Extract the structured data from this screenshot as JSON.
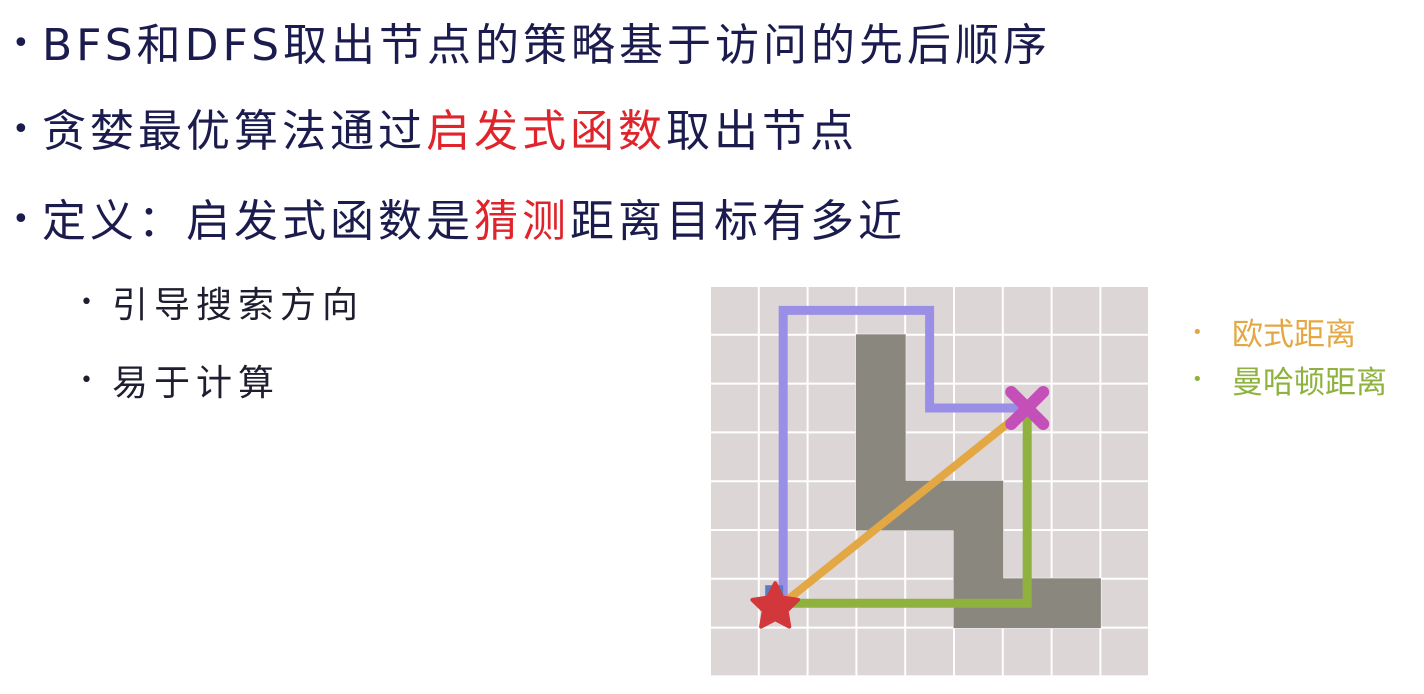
{
  "bullets": [
    {
      "text_before": "BFS和DFS取出节点的策略基于访问的先后顺序",
      "highlight": "",
      "text_after": ""
    },
    {
      "text_before": "贪婪最优算法通过",
      "highlight": "启发式函数",
      "text_after": "取出节点"
    },
    {
      "text_before": "定义：启发式函数是",
      "highlight": "猜测",
      "text_after": "距离目标有多近"
    }
  ],
  "sub_bullets": [
    {
      "text": "引导搜索方向"
    },
    {
      "text": "易于计算"
    }
  ],
  "bullet_glyph": "•",
  "legend": [
    {
      "label": "欧式距离",
      "color": "#e3a844"
    },
    {
      "label": "曼哈顿距离",
      "color": "#8fb23f"
    }
  ],
  "diagram": {
    "grid_cols": 9,
    "grid_rows": 8,
    "obstacle_cells": [
      [
        3,
        1
      ],
      [
        3,
        2
      ],
      [
        3,
        3
      ],
      [
        3,
        4
      ],
      [
        4,
        4
      ],
      [
        5,
        4
      ],
      [
        5,
        5
      ],
      [
        5,
        6
      ],
      [
        6,
        6
      ],
      [
        7,
        6
      ]
    ],
    "start_cell": [
      1,
      6
    ],
    "goal_cell": [
      6,
      2
    ],
    "colors": {
      "grid_bg": "#dcd6d6",
      "grid_line": "#ffffff",
      "obstacle": "#8a877f",
      "path_bfs": "#9a8fe6",
      "euclidean": "#e3a844",
      "manhattan": "#8fb23f",
      "start_marker": "#d1373b",
      "start_square": "#5a7cc4",
      "goal_marker": "#c54fb8",
      "bullet_text": "#1b1b4e",
      "highlight": "#e0242b"
    },
    "purple_path_cells": [
      [
        1,
        6
      ],
      [
        1,
        0
      ],
      [
        4,
        0
      ],
      [
        4,
        2
      ],
      [
        6,
        2
      ]
    ],
    "euclidean_path_cells": [
      [
        1,
        6
      ],
      [
        6,
        2
      ]
    ],
    "manhattan_path_cells": [
      [
        1,
        6
      ],
      [
        6,
        6
      ],
      [
        6,
        2
      ]
    ]
  }
}
